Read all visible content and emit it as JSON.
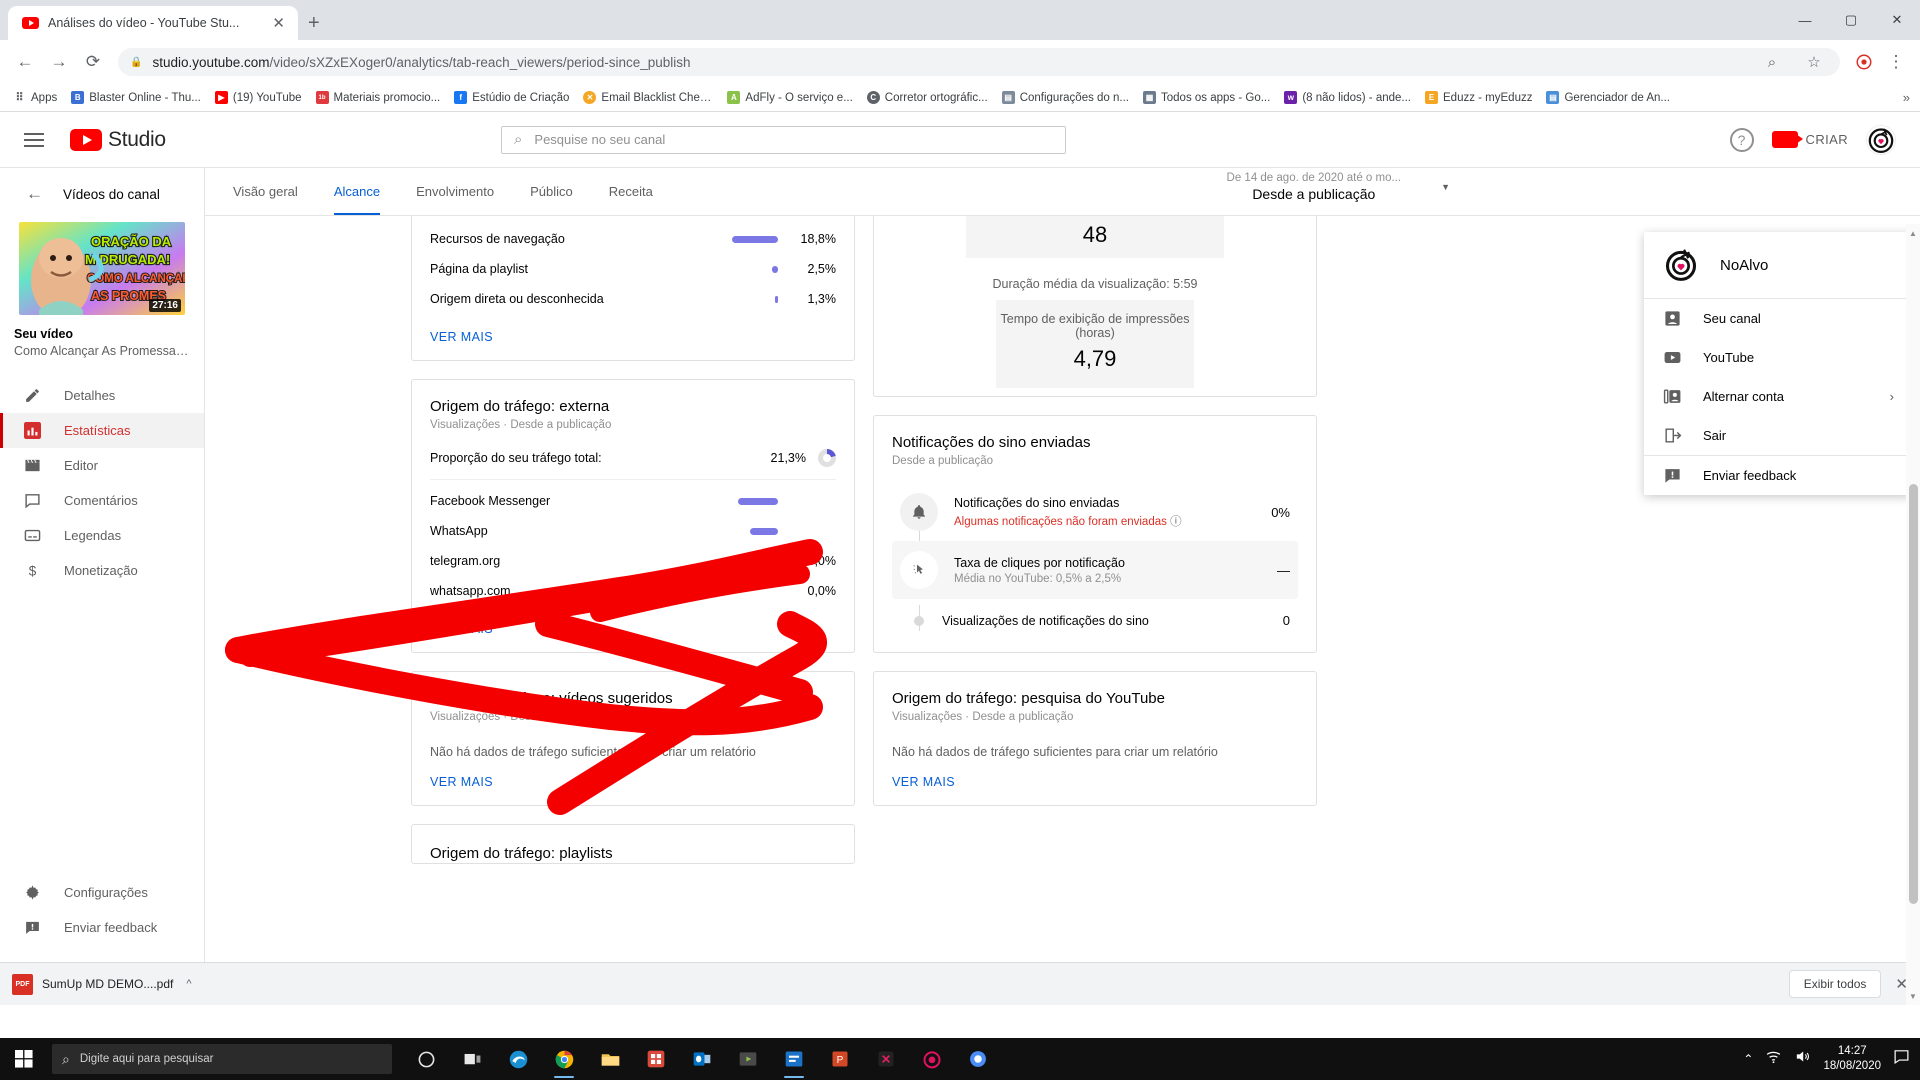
{
  "browser": {
    "tab": {
      "title": "Análises do vídeo - YouTube Stu...",
      "favicon": "youtube-icon",
      "close": "✕",
      "new_tab": "+"
    },
    "window_controls": {
      "minimize": "—",
      "maximize": "▢",
      "close": "✕"
    },
    "nav": {
      "back": "←",
      "forward": "→",
      "reload": "⟳"
    },
    "omnibox": {
      "lock": "🔒",
      "url_domain": "studio.youtube.com",
      "url_path": "/video/sXZxEXoger0/analytics/tab-reach_viewers/period-since_publish",
      "search_icon": "⌕",
      "star_icon": "☆",
      "ext_icon": "extension-icon",
      "menu_icon": "⋮"
    },
    "bookmarks": {
      "apps_label": "Apps",
      "overflow": "»",
      "items": [
        {
          "label": "Blaster Online - Thu...",
          "color": "#3b6fd4",
          "glyph": "B"
        },
        {
          "label": "(19) YouTube",
          "color": "#f00",
          "glyph": "▶"
        },
        {
          "label": "Materiais promocio...",
          "color": "#e03a3e",
          "glyph": "1b"
        },
        {
          "label": "Estúdio de Criação",
          "color": "#1877f2",
          "glyph": "f"
        },
        {
          "label": "Email Blacklist Chec...",
          "color": "#f5a623",
          "glyph": "✕"
        },
        {
          "label": "AdFly - O serviço e...",
          "color": "#8bc34a",
          "glyph": "A"
        },
        {
          "label": "Corretor ortográfic...",
          "color": "#5f6368",
          "glyph": "C"
        },
        {
          "label": "Configurações do n...",
          "color": "#7d8a99",
          "glyph": "▤"
        },
        {
          "label": "Todos os apps - Go...",
          "color": "#6b7a8c",
          "glyph": "▦"
        },
        {
          "label": "(8 não lidos) - ande...",
          "color": "#6b21a8",
          "glyph": "w"
        },
        {
          "label": "Eduzz - myEduzz",
          "color": "#f5a623",
          "glyph": "E"
        },
        {
          "label": "Gerenciador de An...",
          "color": "#4a90d9",
          "glyph": "▤"
        }
      ]
    }
  },
  "studio": {
    "header": {
      "hamburger": "menu-icon",
      "logo_text": "Studio",
      "search_placeholder": "Pesquise no seu canal",
      "help": "?",
      "create_label": "CRIAR"
    },
    "sidebar": {
      "back_label": "Vídeos do canal",
      "video_duration": "27:16",
      "thumbnail_text_1": "ORAÇÃO DA",
      "thumbnail_text_2": "M  DRUGADA!",
      "thumbnail_text_3": "COMO ALCANÇAR",
      "thumbnail_text_4": "AS PROMES",
      "your_video_label": "Seu vídeo",
      "video_title": "Como Alcançar As Promessas De D...",
      "items": [
        {
          "label": "Detalhes",
          "icon": "pencil-icon",
          "active": false
        },
        {
          "label": "Estatísticas",
          "icon": "bar-chart-icon",
          "active": true
        },
        {
          "label": "Editor",
          "icon": "clapperboard-icon",
          "active": false
        },
        {
          "label": "Comentários",
          "icon": "comment-icon",
          "active": false
        },
        {
          "label": "Legendas",
          "icon": "subtitles-icon",
          "active": false
        },
        {
          "label": "Monetização",
          "icon": "dollar-icon",
          "active": false
        }
      ],
      "bottom_items": [
        {
          "label": "Configurações",
          "icon": "gear-icon"
        },
        {
          "label": "Enviar feedback",
          "icon": "feedback-icon"
        }
      ]
    },
    "analytics": {
      "tabs": [
        {
          "label": "Visão geral",
          "selected": false
        },
        {
          "label": "Alcance",
          "selected": true
        },
        {
          "label": "Envolvimento",
          "selected": false
        },
        {
          "label": "Público",
          "selected": false
        },
        {
          "label": "Receita",
          "selected": false
        }
      ],
      "date_range": {
        "range_text": "De 14 de ago. de 2020 até o mo...",
        "preset": "Desde a publicação",
        "caret": "▼"
      },
      "ver_mais": "VER MAIS",
      "cards": {
        "traffic_types_partial": {
          "rows": [
            {
              "label": "Recursos de navegação",
              "value": "18,8%",
              "bar_pct": 18.8
            },
            {
              "label": "Página da playlist",
              "value": "2,5%",
              "bar_pct": 2.5
            },
            {
              "label": "Origem direta ou desconhecida",
              "value": "1,3%",
              "bar_pct": 1.3
            }
          ]
        },
        "funnel_partial": {
          "top_number": "48",
          "mid_label": "Duração média da visualização: 5:59",
          "bottom_label": "Tempo de exibição de impressões (horas)",
          "bottom_number": "4,79"
        },
        "traffic_external": {
          "title": "Origem do tráfego: externa",
          "subtitle": "Visualizações · Desde a publicação",
          "proportion_label": "Proporção do seu tráfego total:",
          "proportion_value": "21,3%",
          "rows": [
            {
              "label": "Facebook Messenger",
              "value": "",
              "bar_pct": 14
            },
            {
              "label": "WhatsApp",
              "value": "",
              "bar_pct": 10
            },
            {
              "label": "telegram.org",
              "value": "0,0%",
              "bar_pct": 0
            },
            {
              "label": "whatsapp.com",
              "value": "0,0%",
              "bar_pct": 0
            }
          ],
          "ver_mais": "VER MAIS"
        },
        "traffic_suggested": {
          "title": "Origem do tráfego: vídeos sugeridos",
          "subtitle": "Visualizações · Desde a publicação",
          "nodata": "Não há dados de tráfego suficientes para criar um relatório",
          "ver_mais": "VER MAIS"
        },
        "traffic_playlists": {
          "title": "Origem do tráfego: playlists"
        },
        "bell_notifications": {
          "title": "Notificações do sino enviadas",
          "subtitle": "Desde a publicação",
          "rows": [
            {
              "label": "Notificações do sino enviadas",
              "note": "Algumas notificações não foram enviadas",
              "note_is_error": true,
              "info_icon": "info-icon",
              "value": "0%",
              "icon": "bell-icon"
            },
            {
              "label": "Taxa de cliques por notificação",
              "note": "Média no YouTube: 0,5% a 2,5%",
              "note_is_error": false,
              "value": "—",
              "icon": "click-icon"
            },
            {
              "label": "Visualizações de notificações do sino",
              "note": "",
              "note_is_error": false,
              "value": "0",
              "icon": "dot-icon"
            }
          ]
        },
        "traffic_yt_search": {
          "title": "Origem do tráfego: pesquisa do YouTube",
          "subtitle": "Visualizações · Desde a publicação",
          "nodata": "Não há dados de tráfego suficientes para criar um relatório",
          "ver_mais": "VER MAIS"
        }
      }
    },
    "account_menu": {
      "channel_name": "NoAlvo",
      "avatar": "target-heart-icon",
      "items": [
        {
          "label": "Seu canal",
          "icon": "person-box-icon",
          "chevron": false
        },
        {
          "label": "YouTube",
          "icon": "youtube-icon",
          "chevron": false
        },
        {
          "label": "Alternar conta",
          "icon": "switch-account-icon",
          "chevron": true
        },
        {
          "label": "Sair",
          "icon": "logout-icon",
          "chevron": false
        }
      ],
      "feedback": {
        "label": "Enviar feedback",
        "icon": "feedback-icon"
      },
      "chevron_glyph": "›"
    }
  },
  "download_bar": {
    "file_name": "SumUp MD DEMO....pdf",
    "file_icon": "pdf-icon",
    "caret": "^",
    "show_all_label": "Exibir todos",
    "close": "✕"
  },
  "taskbar": {
    "start_icon": "windows-icon",
    "search_placeholder": "Digite aqui para pesquisar",
    "search_icon": "⌕",
    "icons": [
      {
        "name": "cortana-icon",
        "glyph": "◯",
        "running": false
      },
      {
        "name": "task-view-icon",
        "glyph": "❐",
        "running": false
      },
      {
        "name": "edge-icon",
        "glyph": "e",
        "running": false
      },
      {
        "name": "chrome-icon",
        "glyph": "◉",
        "running": true
      },
      {
        "name": "file-explorer-icon",
        "glyph": "▤",
        "running": false
      },
      {
        "name": "store-icon",
        "glyph": "▦",
        "running": false
      },
      {
        "name": "outlook-icon",
        "glyph": "O",
        "running": false
      },
      {
        "name": "camtasia-icon",
        "glyph": "▶",
        "running": false
      },
      {
        "name": "app-blue-icon",
        "glyph": "◧",
        "running": true
      },
      {
        "name": "powerpoint-icon",
        "glyph": "P",
        "running": false
      },
      {
        "name": "app-dark-icon",
        "glyph": "✦",
        "running": false
      },
      {
        "name": "noalvo-icon",
        "glyph": "◎",
        "running": false
      },
      {
        "name": "browser2-icon",
        "glyph": "◍",
        "running": false
      }
    ],
    "tray": {
      "up_arrow": "⌃",
      "wifi": "wifi-icon",
      "volume": "volume-icon",
      "action_center": "notification-icon"
    },
    "time": "14:27",
    "date": "18/08/2020"
  },
  "colors": {
    "accent_blue": "#065fd4",
    "youtube_red": "#ff0000",
    "bar_purple": "#7b78e5",
    "error_red": "#d93025",
    "annotation_red": "#f40000"
  }
}
